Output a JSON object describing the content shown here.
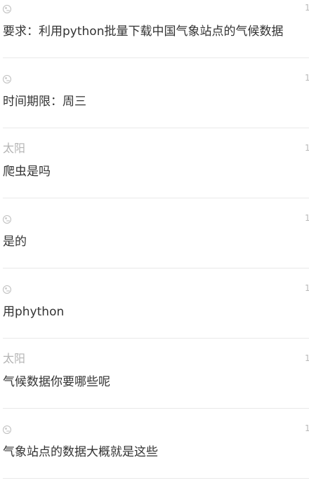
{
  "messages": [
    {
      "sender": "",
      "avatar": "user-avatar-icon",
      "time": "1",
      "text": "要求：利用python批量下载中国气象站点的气候数据"
    },
    {
      "sender": "",
      "avatar": "user-avatar-icon",
      "time": "1",
      "text": "时间期限：周三"
    },
    {
      "sender": "太阳",
      "avatar": "",
      "time": "1",
      "text": "爬虫是吗"
    },
    {
      "sender": "",
      "avatar": "user-avatar-icon",
      "time": "1",
      "text": "是的"
    },
    {
      "sender": "",
      "avatar": "user-avatar-icon",
      "time": "1",
      "text": "用phython"
    },
    {
      "sender": "太阳",
      "avatar": "",
      "time": "1",
      "text": "气候数据你要哪些呢"
    },
    {
      "sender": "",
      "avatar": "user-avatar-icon",
      "time": "1",
      "text": "气象站点的数据大概就是这些"
    }
  ]
}
